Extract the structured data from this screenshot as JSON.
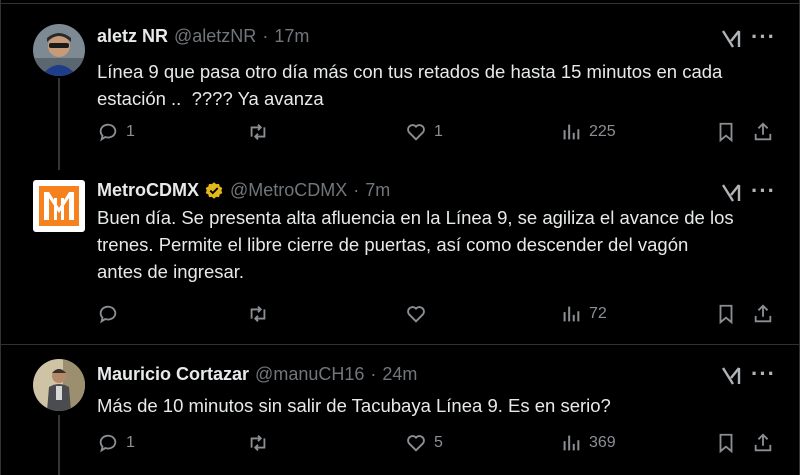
{
  "tweets": [
    {
      "name": "aletz NR",
      "handle": "@aletzNR",
      "sep": "·",
      "time": "17m",
      "text": "Línea 9 que pasa otro día más con tus retados de hasta 15 minutos en cada\nestación ..  ???? Ya avanza",
      "replies": "1",
      "retweets": "",
      "likes": "1",
      "views": "225",
      "verified": false
    },
    {
      "name": "MetroCDMX",
      "handle": "@MetroCDMX",
      "sep": "·",
      "time": "7m",
      "text": "Buen día. Se presenta alta afluencia en la Línea 9, se agiliza el avance de los\ntrenes. Permite el libre cierre de puertas, así como descender del vagón\nantes de ingresar.",
      "replies": "",
      "retweets": "",
      "likes": "",
      "views": "72",
      "verified": true
    },
    {
      "name": "Mauricio Cortazar",
      "handle": "@manuCH16",
      "sep": "·",
      "time": "24m",
      "text": "Más de 10 minutos sin salir de Tacubaya Línea 9. Es en serio?",
      "replies": "1",
      "retweets": "",
      "likes": "5",
      "views": "369",
      "verified": false
    }
  ],
  "icons": {
    "more": "···",
    "metro_logo_text": "M"
  },
  "colors": {
    "background": "#000000",
    "text": "#e7e9ea",
    "muted": "#71767b",
    "verified_gold": "#e2b719",
    "metro_orange": "#f5821f"
  }
}
